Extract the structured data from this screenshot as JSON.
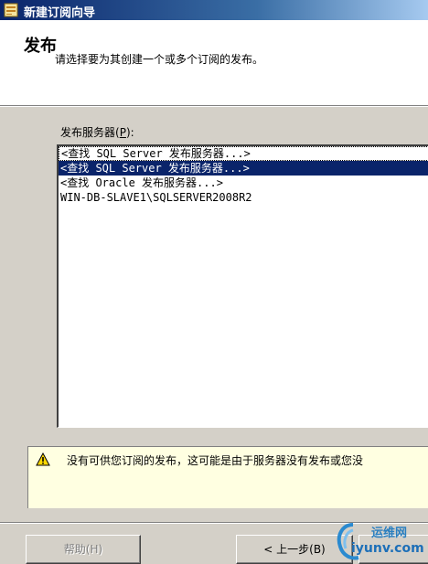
{
  "window": {
    "title": "新建订阅向导"
  },
  "header": {
    "title": "发布",
    "subtitle": "请选择要为其创建一个或多个订阅的发布。"
  },
  "publisher": {
    "label_prefix": "发布服务器(",
    "label_hotkey": "P",
    "label_suffix": "):",
    "items": [
      "<查找 SQL Server 发布服务器...>",
      "<查找 SQL Server 发布服务器...>",
      "<查找 Oracle 发布服务器...>",
      "WIN-DB-SLAVE1\\SQLSERVER2008R2"
    ],
    "selected_index": 1
  },
  "warning": {
    "text": "没有可供您订阅的发布，这可能是由于服务器没有发布或您没"
  },
  "buttons": {
    "help": "帮助(H)",
    "back": "< 上一步(B)",
    "next": ""
  },
  "watermark": {
    "line1": "运维网",
    "line2": "iyunv.com"
  },
  "colors": {
    "selection": "#0a246a",
    "titlebar": "#0a246a",
    "warning_bg": "#ffffe1",
    "dialog_bg": "#d4d0c8"
  }
}
